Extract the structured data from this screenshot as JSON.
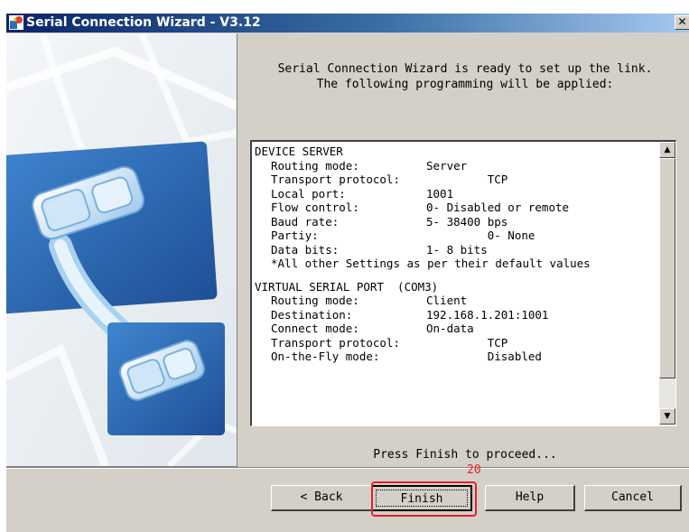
{
  "window": {
    "title": "Serial Connection Wizard - V3.12",
    "close_glyph": "✕",
    "app_icon": "wizard-app-icon"
  },
  "intro": {
    "line1": "Serial Connection Wizard is ready to set up the link.",
    "line2": "The following programming will be applied:"
  },
  "summary": {
    "device_server": {
      "header": "DEVICE SERVER",
      "rows": [
        {
          "k": "Routing mode:",
          "v": "Server"
        },
        {
          "k": "Transport protocol:",
          "v": "         TCP"
        },
        {
          "k": "Local port:",
          "v": "1001"
        },
        {
          "k": "Flow control:",
          "v": "0- Disabled or remote"
        },
        {
          "k": "Baud rate:",
          "v": "5- 38400 bps"
        },
        {
          "k": "Partiy:",
          "v": "         0- None"
        },
        {
          "k": "Data bits:",
          "v": "1- 8 bits"
        }
      ],
      "note": "*All other Settings as per their default values"
    },
    "virtual_port": {
      "header": "VIRTUAL SERIAL PORT  (COM3)",
      "rows": [
        {
          "k": "Routing mode:",
          "v": "Client"
        },
        {
          "k": "Destination:",
          "v": "192.168.1.201:1001"
        },
        {
          "k": "Connect mode:",
          "v": "On-data"
        },
        {
          "k": "Transport protocol:",
          "v": "         TCP"
        },
        {
          "k": "On-the-Fly mode:",
          "v": "         Disabled"
        }
      ]
    }
  },
  "scrollbar": {
    "up_glyph": "▲",
    "down_glyph": "▼",
    "thumb_fraction": 0.88
  },
  "hint": "Press Finish to proceed...",
  "buttons": {
    "back": "< Back",
    "finish": "Finish",
    "help": "Help",
    "cancel": "Cancel"
  },
  "annotation": {
    "number": "20",
    "color": "#e8202a"
  },
  "colors": {
    "title_start": "#0a246a",
    "title_end": "#a6caf0",
    "face": "#d4d0c8",
    "art_blue": "#2f6db0"
  }
}
